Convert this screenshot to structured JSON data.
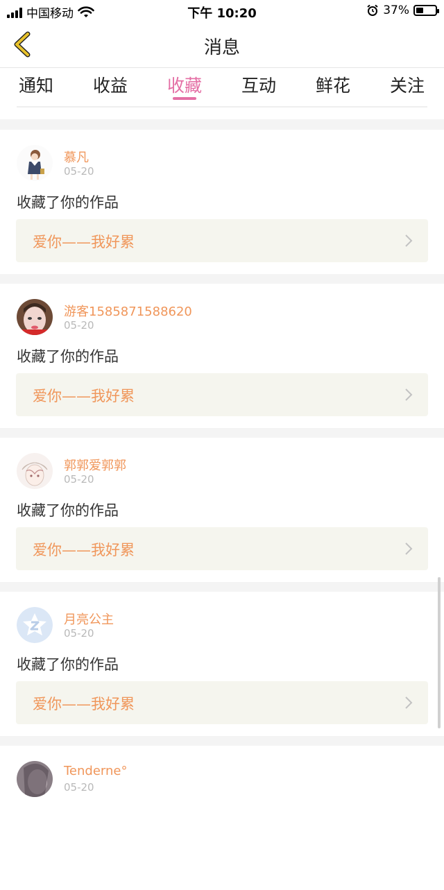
{
  "status_bar": {
    "carrier": "中国移动",
    "time": "下午 10:20",
    "battery_percent": "37%",
    "battery_level": 0.37
  },
  "nav": {
    "title": "消息"
  },
  "tabs": [
    {
      "label": "通知"
    },
    {
      "label": "收益"
    },
    {
      "label": "收藏"
    },
    {
      "label": "互动"
    },
    {
      "label": "鲜花"
    },
    {
      "label": "关注"
    }
  ],
  "active_tab": "收藏",
  "messages": [
    {
      "username": "慕凡",
      "date": "05-20",
      "action": "收藏了你的作品",
      "work_title": "爱你——我好累"
    },
    {
      "username": "游客1585871588620",
      "date": "05-20",
      "action": "收藏了你的作品",
      "work_title": "爱你——我好累"
    },
    {
      "username": "郭郭爱郭郭",
      "date": "05-20",
      "action": "收藏了你的作品",
      "work_title": "爱你——我好累"
    },
    {
      "username": "月亮公主",
      "date": "05-20",
      "action": "收藏了你的作品",
      "work_title": "爱你——我好累"
    },
    {
      "username": "Tenderne°",
      "date": "05-20"
    }
  ],
  "colors": {
    "accent_pink": "#e46fa5",
    "name_orange": "#f0965a",
    "back_yellow": "#e8c22b",
    "work_box_bg": "#f5f5ee"
  }
}
